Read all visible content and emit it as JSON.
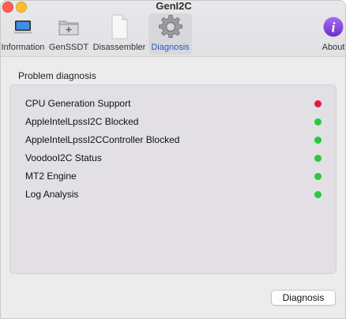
{
  "window": {
    "title": "GenI2C"
  },
  "toolbar": {
    "items": [
      {
        "label": "Information",
        "icon": "laptop-icon"
      },
      {
        "label": "GenSSDT",
        "icon": "folder-plus-icon"
      },
      {
        "label": "Disassembler",
        "icon": "document-icon"
      },
      {
        "label": "Diagnosis",
        "icon": "gear-icon",
        "selected": true
      },
      {
        "label": "About",
        "icon": "info-icon"
      }
    ]
  },
  "main": {
    "section_label": "Problem diagnosis",
    "checks": [
      {
        "name": "CPU Generation Support",
        "status": "fail"
      },
      {
        "name": "AppleIntelLpssI2C Blocked",
        "status": "ok"
      },
      {
        "name": "AppleIntelLpssI2CController Blocked",
        "status": "ok"
      },
      {
        "name": "VoodooI2C Status",
        "status": "ok"
      },
      {
        "name": "MT2 Engine",
        "status": "ok"
      },
      {
        "name": "Log Analysis",
        "status": "ok"
      }
    ],
    "diagnose_button_label": "Diagnosis"
  },
  "colors": {
    "status_ok": "#27c93f",
    "status_fail": "#e8183d",
    "selected_label": "#2a55c6"
  }
}
